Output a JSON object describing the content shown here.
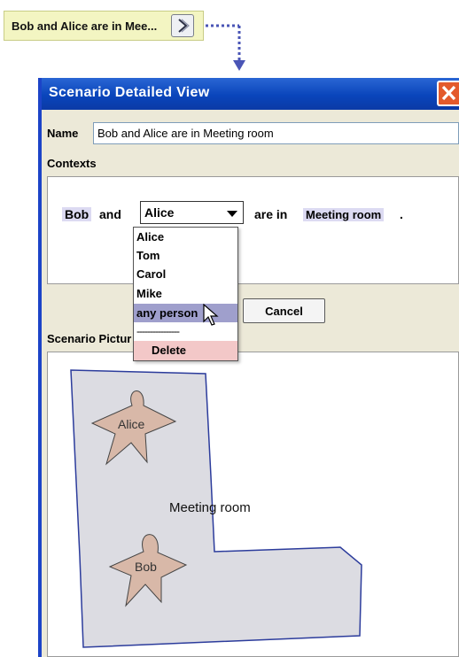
{
  "scenario_tag": {
    "label": "Bob and Alice are in Mee...",
    "expand_icon": "chevron-right-icon"
  },
  "window": {
    "title": "Scenario Detailed View",
    "close_icon": "close-icon"
  },
  "form": {
    "name_label": "Name",
    "name_value": "Bob and Alice are in Meeting room",
    "contexts_label": "Contexts"
  },
  "sentence": {
    "subject": "Bob",
    "conjunction": "and",
    "person_selected": "Alice",
    "verb": "are in",
    "place": "Meeting room",
    "period": "."
  },
  "dropdown": {
    "options": [
      "Alice",
      "Tom",
      "Carol",
      "Mike",
      "any person"
    ],
    "highlighted": "any person",
    "separator": "----------------",
    "delete_label": "Delete"
  },
  "buttons": {
    "cancel": "Cancel"
  },
  "picture": {
    "label": "Scenario Pictur",
    "room_label": "Meeting room",
    "figure_1": "Alice",
    "figure_2": "Bob"
  },
  "colors": {
    "titlebar": "#0a45bb",
    "tag_background": "#f3f5c2",
    "highlight_token": "#dcdaf2",
    "dropdown_selection": "#9f9fcc",
    "delete_background": "#f3c8c8",
    "room_fill": "#dcdce2",
    "room_stroke": "#2c3c9c",
    "person_fill": "#d8b8a8"
  }
}
